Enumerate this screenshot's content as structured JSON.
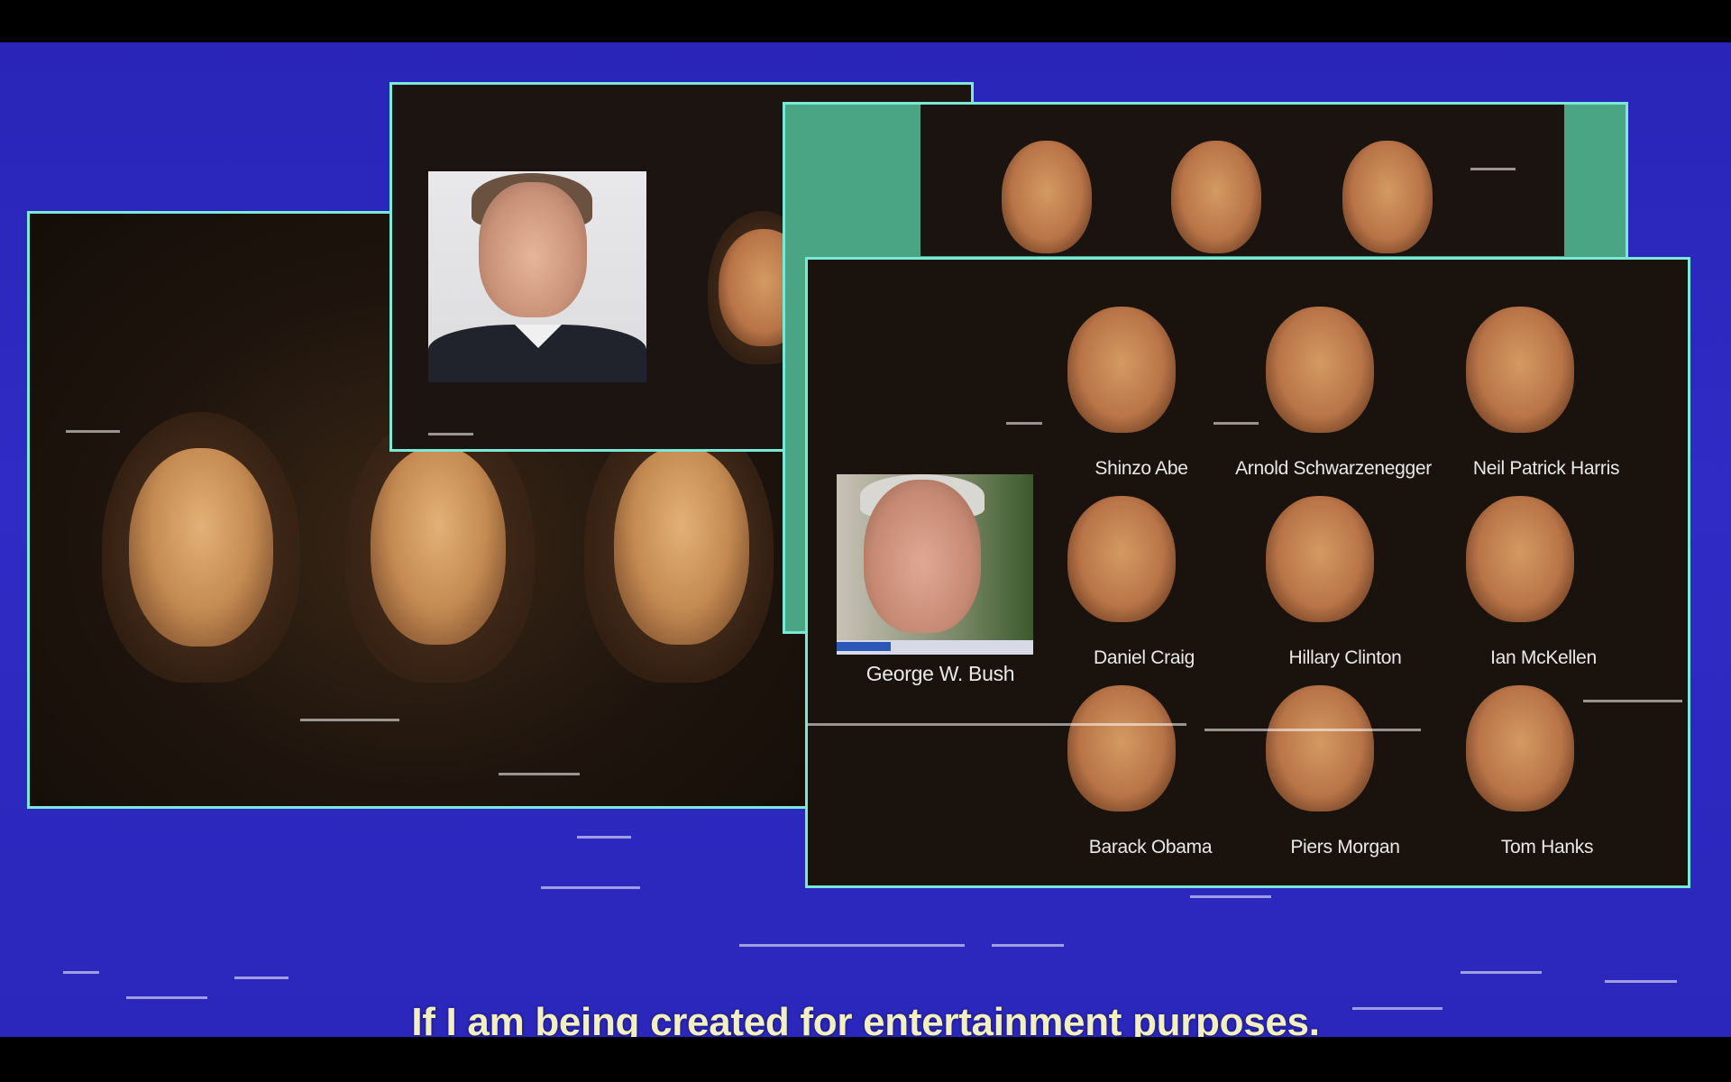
{
  "video": {
    "subtitle": "If I am being created for entertainment purposes."
  },
  "grid_panel": {
    "featured_person": "George W. Bush",
    "faces": [
      {
        "label": "Shinzo Abe"
      },
      {
        "label": "Arnold Schwarzenegger"
      },
      {
        "label": "Neil Patrick Harris"
      },
      {
        "label": "Daniel Craig"
      },
      {
        "label": "Hillary Clinton"
      },
      {
        "label": "Ian McKellen"
      },
      {
        "label": "Barack Obama"
      },
      {
        "label": "Piers Morgan"
      },
      {
        "label": "Tom Hanks"
      }
    ]
  },
  "colors": {
    "background": "#2f2bc4",
    "panel_border": "#7be8d8",
    "subtitle_text": "#f2f0c2",
    "accent_green": "#4aa585"
  }
}
